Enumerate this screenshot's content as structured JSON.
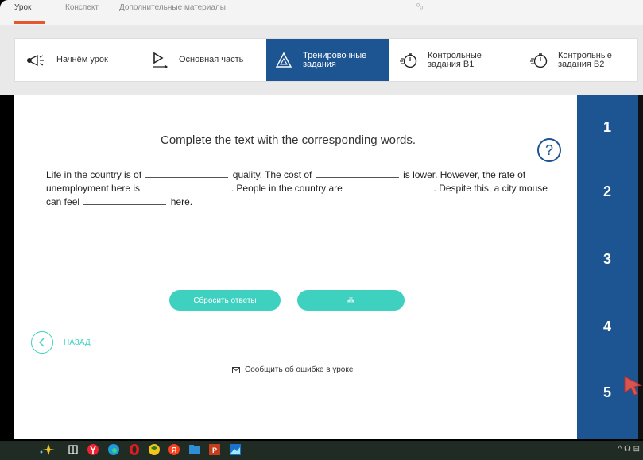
{
  "top_tabs": [
    {
      "label": "Урок"
    },
    {
      "label": "Конспект"
    },
    {
      "label": "Дополнительные материалы"
    }
  ],
  "top_search_glyph": "ᵒₒ",
  "sections": [
    {
      "label": "Начнём урок",
      "icon": "megaphone-icon"
    },
    {
      "label": "Основная часть",
      "icon": "play-icon"
    },
    {
      "label": "Тренировочные задания",
      "icon": "triangle-icon",
      "active": true
    },
    {
      "label": "Контрольные задания В1",
      "icon": "stopwatch-icon"
    },
    {
      "label": "Контрольные задания В2",
      "icon": "stopwatch-icon"
    }
  ],
  "task": {
    "instruction": "Complete the text with the corresponding words.",
    "help_glyph": "?",
    "segments": [
      "Life in the country is of",
      "quality. The cost of",
      "is lower. However, the rate of unemployment here is",
      ". People in the country are",
      ". Despite this, a city mouse can feel",
      "here."
    ]
  },
  "buttons": {
    "reset": "Сбросить ответы",
    "check_glyph": "⁂"
  },
  "back_label": "НАЗАД",
  "report_label": "Сообщить об ошибке в уроке",
  "steps": [
    "1",
    "2",
    "3",
    "4",
    "5"
  ],
  "taskbar": {
    "icons": [
      "sparkle-icon",
      "task-view-icon",
      "yandex-icon",
      "edge-icon",
      "opera-icon",
      "browser-icon",
      "yandex-browser-icon",
      "files-icon",
      "powerpoint-icon",
      "photos-icon"
    ],
    "tray": "^ ☊ ⊟"
  },
  "colors": {
    "accent_blue": "#1d5492",
    "teal": "#3fd1c0",
    "tab_underline": "#e4572e"
  }
}
